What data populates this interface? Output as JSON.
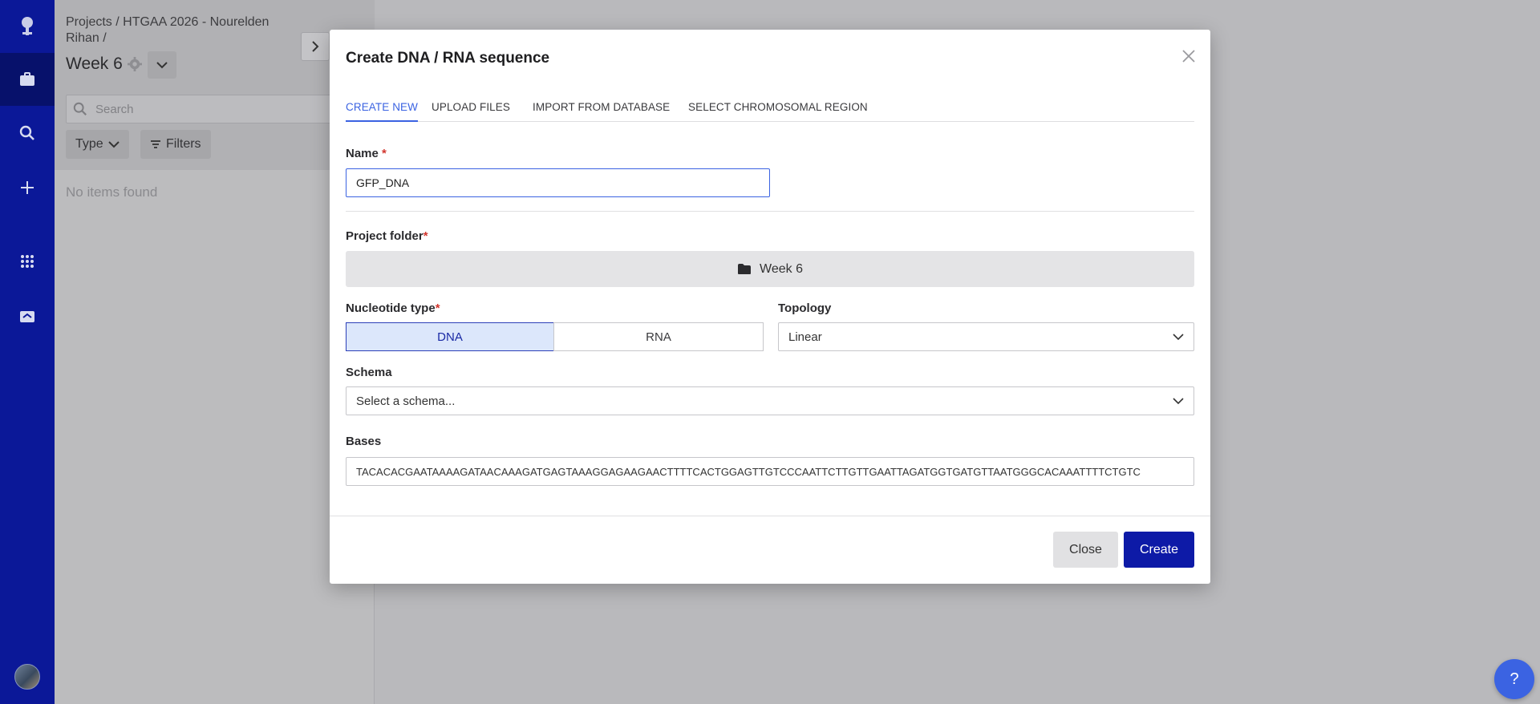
{
  "sidebar": {
    "icons": [
      "logo-icon",
      "projects-icon",
      "search-icon",
      "plus-icon",
      "apps-grid-icon",
      "inbox-icon"
    ],
    "active_index": 1
  },
  "panel": {
    "breadcrumb": "Projects / HTGAA 2026 - Nourelden Rihan /",
    "folder_title": "Week 6",
    "search_placeholder": "Search",
    "type_filter_label": "Type",
    "filters_label": "Filters",
    "empty_text": "No items found"
  },
  "modal": {
    "title": "Create DNA / RNA sequence",
    "tabs": [
      {
        "label": "CREATE NEW",
        "active": true
      },
      {
        "label": "UPLOAD FILES",
        "active": false
      },
      {
        "label": "IMPORT FROM DATABASE",
        "active": false
      },
      {
        "label": "SELECT CHROMOSOMAL REGION",
        "active": false
      }
    ],
    "name_label": "Name",
    "name_value": "GFP_DNA",
    "project_folder_label": "Project folder",
    "project_folder_value": "Week 6",
    "nucleotide_label": "Nucleotide type",
    "nucleotide_options": [
      "DNA",
      "RNA"
    ],
    "nucleotide_selected": "DNA",
    "topology_label": "Topology",
    "topology_value": "Linear",
    "schema_label": "Schema",
    "schema_placeholder": "Select a schema...",
    "bases_label": "Bases",
    "bases_value": "TACACACGAATAAAAGATAACAAAGATGAGTAAAGGAGAAGAACTTTTCACTGGAGTTGTCCCAATTCTTGTTGAATTAGATGGTGATGTTAATGGGCACAAATTTTCTGTC",
    "close_label": "Close",
    "create_label": "Create"
  },
  "help": {
    "label": "?"
  },
  "colors": {
    "rail": "#0b1898",
    "accent": "#3b63e2",
    "primary_button": "#0d1aa7",
    "required": "#d2362e"
  }
}
